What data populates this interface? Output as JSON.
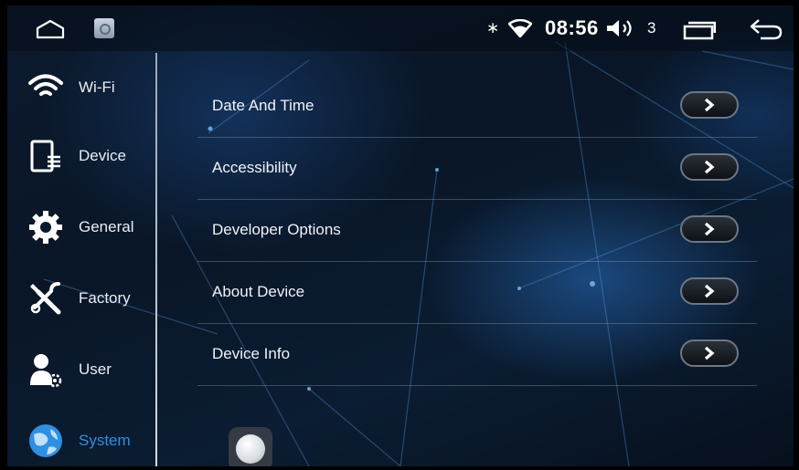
{
  "status_bar": {
    "time": "08:56",
    "volume_level": "3",
    "bluetooth_glyph": "∗",
    "icons": [
      "home-icon",
      "settings-app-icon",
      "bluetooth-icon",
      "wifi-icon",
      "volume-icon",
      "recent-apps-icon",
      "back-icon"
    ]
  },
  "sidebar": {
    "items": [
      {
        "label": "Wi-Fi",
        "icon": "wifi-icon",
        "active": false
      },
      {
        "label": "Device",
        "icon": "device-icon",
        "active": false
      },
      {
        "label": "General",
        "icon": "gear-icon",
        "active": false
      },
      {
        "label": "Factory",
        "icon": "tools-icon",
        "active": false
      },
      {
        "label": "User",
        "icon": "user-icon",
        "active": false
      },
      {
        "label": "System",
        "icon": "globe-icon",
        "active": true
      }
    ]
  },
  "content": {
    "rows": [
      {
        "label": "Date And Time"
      },
      {
        "label": "Accessibility"
      },
      {
        "label": "Developer Options"
      },
      {
        "label": "About Device"
      },
      {
        "label": "Device Info"
      }
    ]
  },
  "colors": {
    "accent": "#2f8fe0",
    "text": "#f0f3f7",
    "background": "#0b1a2e"
  }
}
